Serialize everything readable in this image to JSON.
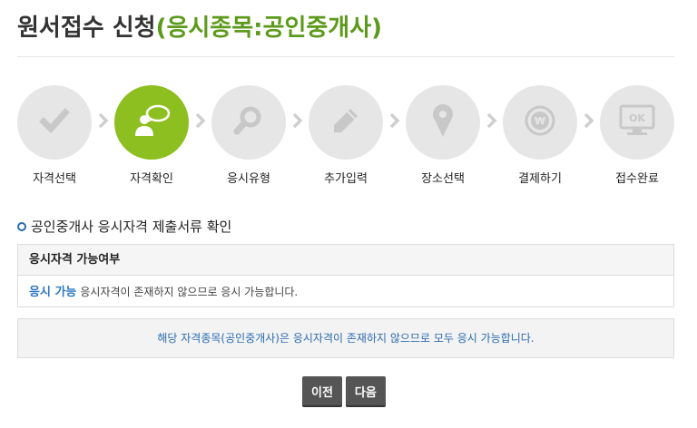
{
  "header": {
    "title": "원서접수 신청",
    "subtitle": "(응시종목:공인중개사)"
  },
  "steps": [
    {
      "label": "자격선택",
      "icon": "check-icon",
      "active": false
    },
    {
      "label": "자격확인",
      "icon": "person-speech-icon",
      "active": true
    },
    {
      "label": "응시유형",
      "icon": "magnifier-icon",
      "active": false
    },
    {
      "label": "추가입력",
      "icon": "pencil-icon",
      "active": false
    },
    {
      "label": "장소선택",
      "icon": "location-pin-icon",
      "active": false
    },
    {
      "label": "결제하기",
      "icon": "won-coin-icon",
      "active": false
    },
    {
      "label": "접수완료",
      "icon": "monitor-ok-icon",
      "active": false,
      "icon_text": "OK"
    }
  ],
  "section": {
    "title": "공인중개사 응시자격 제출서류 확인"
  },
  "eligibility_table": {
    "header": "응시자격 가능여부",
    "status": "응시 가능",
    "message": "응시자격이 존재하지 않으므로 응시 가능합니다."
  },
  "notice": "해당 자격종목(공인중개사)은 응시자격이 존재하지 않으므로 모두 응시 가능합니다.",
  "buttons": {
    "prev": "이전",
    "next": "다음"
  },
  "colors": {
    "accent_green": "#8cbf1f",
    "subtitle_green": "#5c9a1b",
    "link_blue": "#2b77c5",
    "inactive_gray": "#e6e6e6"
  }
}
